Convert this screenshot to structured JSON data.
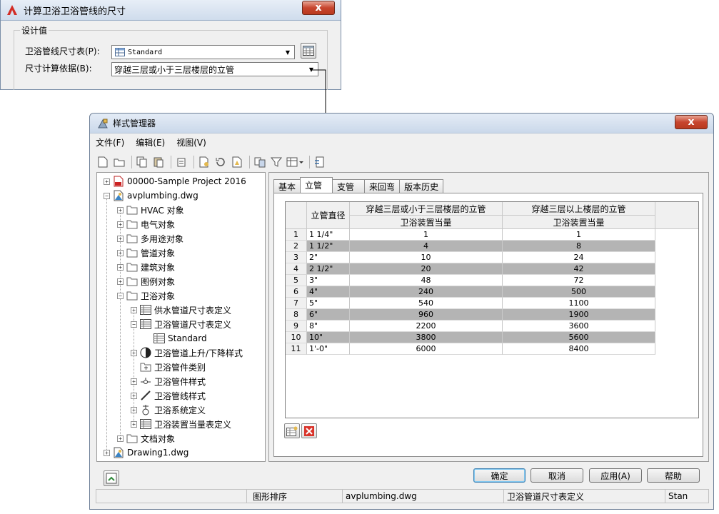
{
  "calc_dialog": {
    "title": "计算卫浴卫浴管线的尺寸",
    "group_title": "设计值",
    "pipe_size_label": "卫浴管线尺寸表(P):",
    "pipe_size_value": "Standard",
    "basis_label": "尺寸计算依据(B):",
    "basis_value": "穿越三层或小于三层楼层的立管",
    "close_label": "x"
  },
  "style_manager": {
    "title": "样式管理器",
    "close_label": "x",
    "menu": [
      "文件(F)",
      "编辑(E)",
      "视图(V)"
    ],
    "tree": {
      "sample_project": "00000-Sample Project 2016",
      "avplumbing": "avplumbing.dwg",
      "hvac": "HVAC 对象",
      "electrical": "电气对象",
      "multipurpose": "多用途对象",
      "piping": "管道对象",
      "architectural": "建筑对象",
      "legend": "图例对象",
      "plumbing": "卫浴对象",
      "supply_pipe_size": "供水管道尺寸表定义",
      "plumbing_pipe_size": "卫浴管道尺寸表定义",
      "standard": "Standard",
      "rise_drop": "卫浴管道上升/下降样式",
      "fitting_class": "卫浴管件类别",
      "fitting_style": "卫浴管件样式",
      "line_style": "卫浴管线样式",
      "system_def": "卫浴系统定义",
      "fixture_unit": "卫浴装置当量表定义",
      "document": "文档对象",
      "drawing1": "Drawing1.dwg"
    },
    "tabs": [
      "基本",
      "立管",
      "支管",
      "来回弯",
      "版本历史"
    ],
    "active_tab": "立管",
    "table": {
      "col_diameter": "立管直径",
      "col_le3": "穿越三层或小于三层楼层的立管",
      "col_gt3": "穿越三层以上楼层的立管",
      "sub_unit": "卫浴装置当量",
      "rows": [
        {
          "n": "1",
          "d": "1 1/4\"",
          "a": "1",
          "b": "1"
        },
        {
          "n": "2",
          "d": "1 1/2\"",
          "a": "4",
          "b": "8"
        },
        {
          "n": "3",
          "d": "2\"",
          "a": "10",
          "b": "24"
        },
        {
          "n": "4",
          "d": "2 1/2\"",
          "a": "20",
          "b": "42"
        },
        {
          "n": "5",
          "d": "3\"",
          "a": "48",
          "b": "72"
        },
        {
          "n": "6",
          "d": "4\"",
          "a": "240",
          "b": "500"
        },
        {
          "n": "7",
          "d": "5\"",
          "a": "540",
          "b": "1100"
        },
        {
          "n": "8",
          "d": "6\"",
          "a": "960",
          "b": "1900"
        },
        {
          "n": "9",
          "d": "8\"",
          "a": "2200",
          "b": "3600"
        },
        {
          "n": "10",
          "d": "10\"",
          "a": "3800",
          "b": "5600"
        },
        {
          "n": "11",
          "d": "1'-0\"",
          "a": "6000",
          "b": "8400"
        }
      ]
    },
    "buttons": {
      "ok": "确定",
      "cancel": "取消",
      "apply": "应用(A)",
      "help": "帮助"
    },
    "status": {
      "s1": "",
      "s2": "图形排序",
      "s3": "avplumbing.dwg",
      "s4": "卫浴管道尺寸表定义",
      "s5": "Stan"
    },
    "colors": {
      "alt_row": "#b4b4b4",
      "close_red": "#c7452e"
    }
  }
}
